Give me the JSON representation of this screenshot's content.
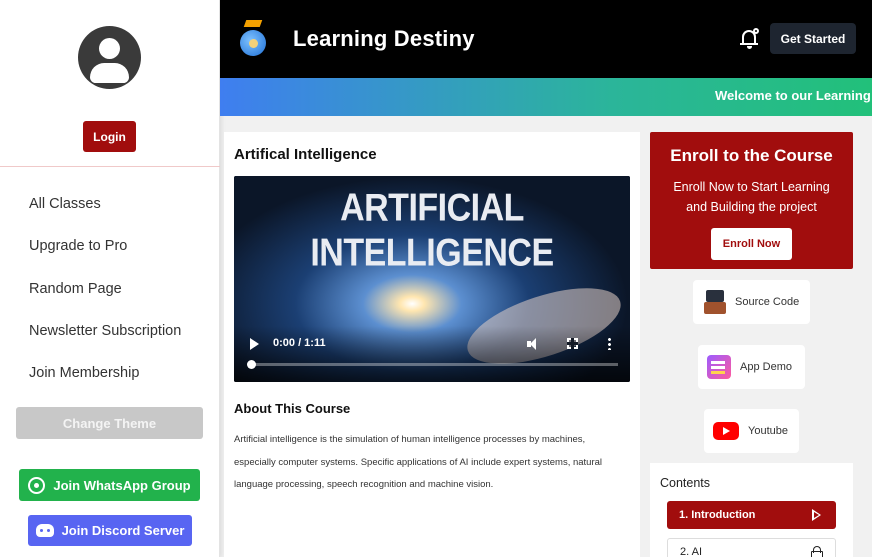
{
  "sidebar": {
    "login_label": "Login",
    "nav_items": [
      {
        "label": "All Classes"
      },
      {
        "label": "Upgrade to Pro"
      },
      {
        "label": "Random Page"
      },
      {
        "label": "Newsletter Subscription"
      },
      {
        "label": "Join Membership"
      }
    ],
    "theme_label": "Change Theme",
    "whatsapp_label": "Join WhatsApp Group",
    "discord_label": "Join Discord Server"
  },
  "header": {
    "brand": "Learning Destiny",
    "cta_label": "Get Started",
    "marquee": "Welcome to our Learning Destiny"
  },
  "course": {
    "title": "Artifical Intelligence",
    "video": {
      "thumbnail_text": "ARTIFICIAL INTELLIGENCE",
      "time": "0:00 / 1:11",
      "progress": 0
    },
    "about_title": "About This Course",
    "about_text": "Artificial intelligence is the simulation of human intelligence processes by machines, especially computer systems. Specific applications of AI include expert systems, natural language processing, speech recognition and machine vision."
  },
  "enroll": {
    "title": "Enroll to the Course",
    "subtitle": "Enroll Now to Start Learning and Building the project",
    "button_label": "Enroll Now"
  },
  "resources": {
    "source_label": "Source Code",
    "demo_label": "App Demo",
    "youtube_label": "Youtube"
  },
  "contents": {
    "title": "Contents",
    "lessons": [
      {
        "label": "1. Introduction",
        "state": "active"
      },
      {
        "label": "2. AI",
        "state": "locked"
      }
    ]
  },
  "colors": {
    "accent": "#a10d0d",
    "whatsapp": "#22b24c",
    "discord": "#5865f2",
    "header_bg": "#000000"
  }
}
